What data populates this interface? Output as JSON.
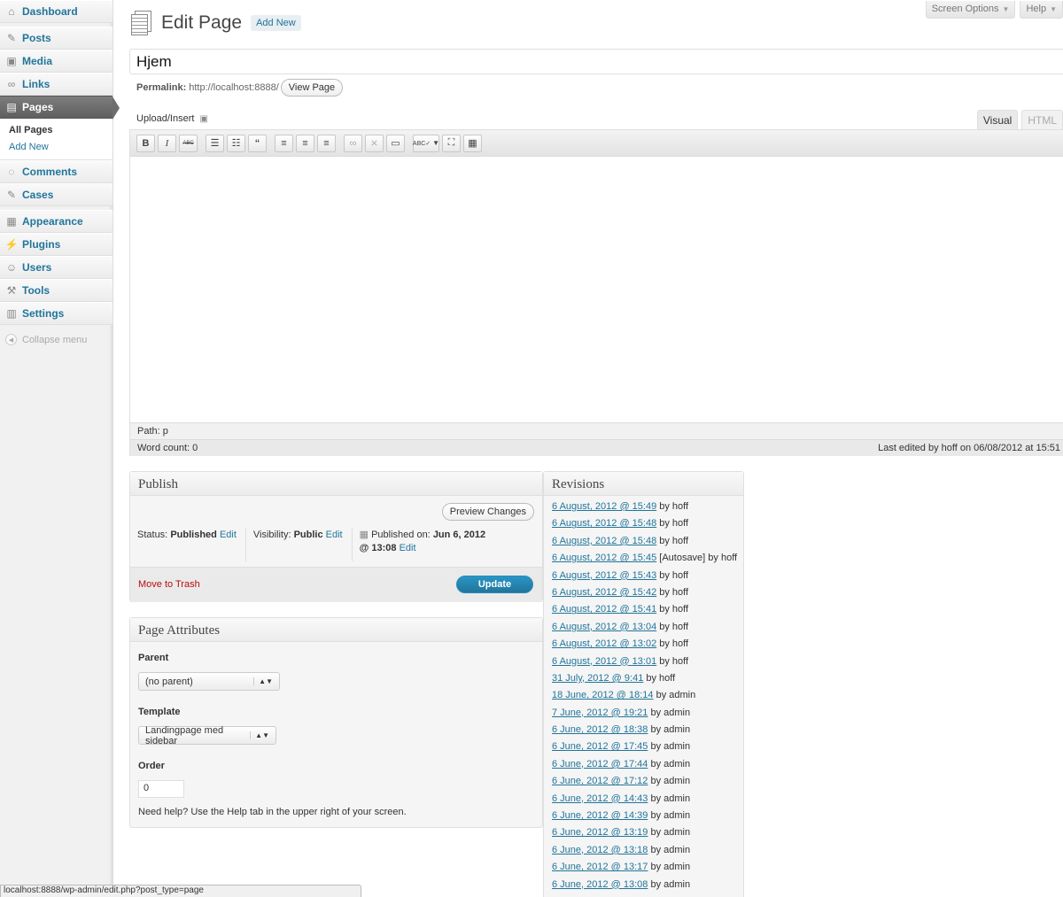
{
  "sidebar": {
    "items": [
      {
        "label": "Dashboard",
        "icon": "house-icon"
      },
      {
        "label": "Posts",
        "icon": "pin-icon"
      },
      {
        "label": "Media",
        "icon": "media-icon"
      },
      {
        "label": "Links",
        "icon": "link-icon"
      },
      {
        "label": "Pages",
        "icon": "pages-icon"
      },
      {
        "label": "Comments",
        "icon": "comment-icon"
      },
      {
        "label": "Cases",
        "icon": "pin-icon"
      },
      {
        "label": "Appearance",
        "icon": "appearance-icon"
      },
      {
        "label": "Plugins",
        "icon": "plugin-icon"
      },
      {
        "label": "Users",
        "icon": "users-icon"
      },
      {
        "label": "Tools",
        "icon": "tools-icon"
      },
      {
        "label": "Settings",
        "icon": "settings-icon"
      }
    ],
    "submenu": {
      "all_pages": "All Pages",
      "add_new": "Add New"
    },
    "collapse": "Collapse menu"
  },
  "header": {
    "screen_options": "Screen Options",
    "help": "Help",
    "title": "Edit Page",
    "add_new": "Add New"
  },
  "post": {
    "title": "Hjem",
    "permalink_label": "Permalink:",
    "permalink_url": "http://localhost:8888/",
    "view_page": "View Page"
  },
  "editor": {
    "upload_insert": "Upload/Insert",
    "tab_visual": "Visual",
    "tab_html": "HTML",
    "path": "Path: p",
    "word_count": "Word count: 0",
    "last_edited": "Last edited by hoff on 06/08/2012 at 15:51"
  },
  "publish": {
    "title": "Publish",
    "preview": "Preview Changes",
    "status_label": "Status:",
    "status_value": "Published",
    "edit": "Edit",
    "visibility_label": "Visibility:",
    "visibility_value": "Public",
    "published_label": "Published on:",
    "published_date": "Jun 6, 2012",
    "published_time": "@ 13:08",
    "trash": "Move to Trash",
    "update": "Update"
  },
  "attributes": {
    "title": "Page Attributes",
    "parent_label": "Parent",
    "parent_value": "(no parent)",
    "template_label": "Template",
    "template_value": "Landingpage med sidebar",
    "order_label": "Order",
    "order_value": "0",
    "help": "Need help? Use the Help tab in the upper right of your screen."
  },
  "revisions": {
    "title": "Revisions",
    "items": [
      {
        "date": "6 August, 2012 @ 15:49",
        "suffix": " by hoff"
      },
      {
        "date": "6 August, 2012 @ 15:48",
        "suffix": " by hoff"
      },
      {
        "date": "6 August, 2012 @ 15:48",
        "suffix": " by hoff"
      },
      {
        "date": "6 August, 2012 @ 15:45",
        "suffix": " [Autosave] by hoff"
      },
      {
        "date": "6 August, 2012 @ 15:43",
        "suffix": " by hoff"
      },
      {
        "date": "6 August, 2012 @ 15:42",
        "suffix": " by hoff"
      },
      {
        "date": "6 August, 2012 @ 15:41",
        "suffix": " by hoff"
      },
      {
        "date": "6 August, 2012 @ 13:04",
        "suffix": " by hoff"
      },
      {
        "date": "6 August, 2012 @ 13:02",
        "suffix": " by hoff"
      },
      {
        "date": "6 August, 2012 @ 13:01",
        "suffix": " by hoff"
      },
      {
        "date": "31 July, 2012 @ 9:41",
        "suffix": " by hoff"
      },
      {
        "date": "18 June, 2012 @ 18:14",
        "suffix": " by admin"
      },
      {
        "date": "7 June, 2012 @ 19:21",
        "suffix": " by admin"
      },
      {
        "date": "6 June, 2012 @ 18:38",
        "suffix": " by admin"
      },
      {
        "date": "6 June, 2012 @ 17:45",
        "suffix": " by admin"
      },
      {
        "date": "6 June, 2012 @ 17:44",
        "suffix": " by admin"
      },
      {
        "date": "6 June, 2012 @ 17:12",
        "suffix": " by admin"
      },
      {
        "date": "6 June, 2012 @ 14:43",
        "suffix": " by admin"
      },
      {
        "date": "6 June, 2012 @ 14:39",
        "suffix": " by admin"
      },
      {
        "date": "6 June, 2012 @ 13:19",
        "suffix": " by admin"
      },
      {
        "date": "6 June, 2012 @ 13:18",
        "suffix": " by admin"
      },
      {
        "date": "6 June, 2012 @ 13:17",
        "suffix": " by admin"
      },
      {
        "date": "6 June, 2012 @ 13:08",
        "suffix": " by admin"
      }
    ]
  },
  "statusbar": "localhost:8888/wp-admin/edit.php?post_type=page",
  "colors": {
    "link": "#21759b",
    "trash": "#bc0b0b",
    "update": "#21759b"
  }
}
